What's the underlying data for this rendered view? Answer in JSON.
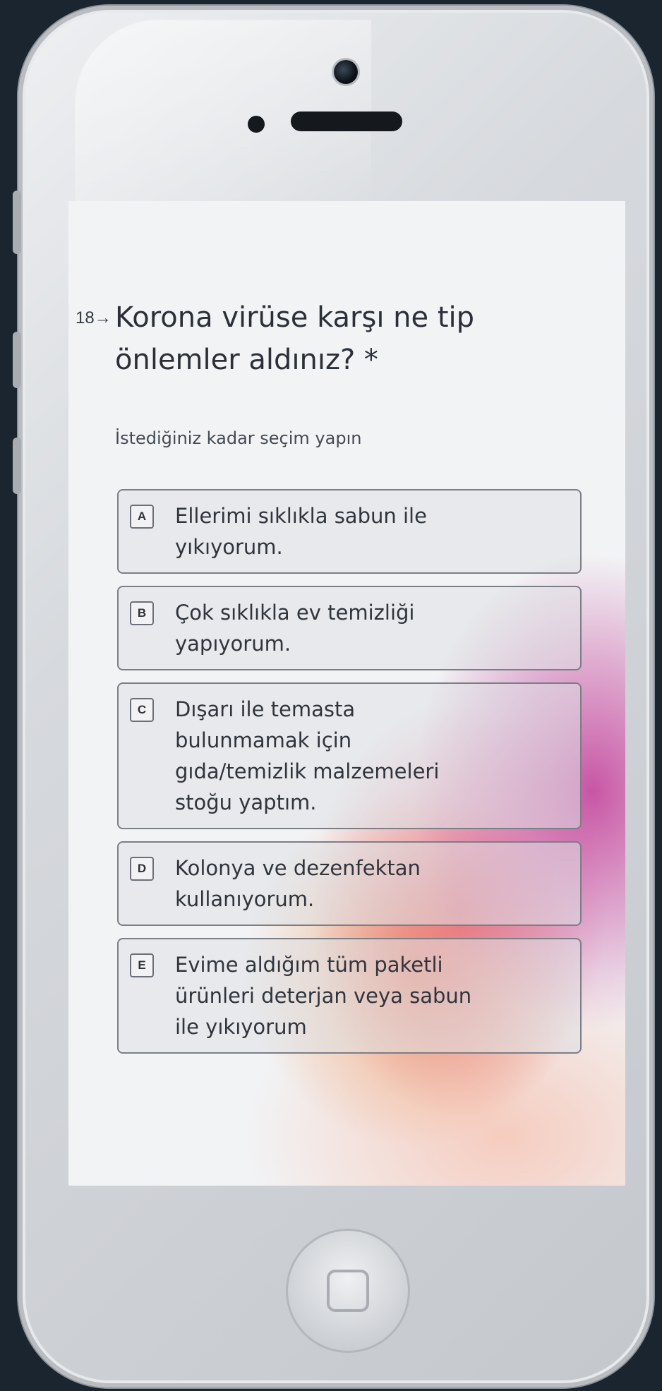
{
  "question": {
    "number": "18→",
    "title": "Korona virüse karşı ne tip önlemler aldınız? *",
    "hint": "İstediğiniz kadar seçim yapın"
  },
  "options": [
    {
      "key": "A",
      "label": "Ellerimi sıklıkla sabun ile\nyıkıyorum."
    },
    {
      "key": "B",
      "label": "Çok sıklıkla ev temizliği\nyapıyorum."
    },
    {
      "key": "C",
      "label": "Dışarı ile temasta\nbulunmamak için\ngıda/temizlik malzemeleri\nstoğu yaptım."
    },
    {
      "key": "D",
      "label": "Kolonya ve dezenfektan\nkullanıyorum."
    },
    {
      "key": "E",
      "label": "Evime aldığım tüm paketli\nürünleri deterjan veya sabun\nile yıkıyorum"
    }
  ]
}
